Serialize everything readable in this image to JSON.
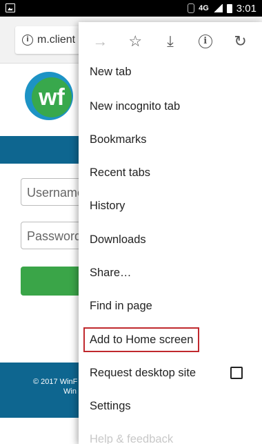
{
  "status_bar": {
    "network": "4G",
    "time": "3:01"
  },
  "address_bar": {
    "url": "m.client"
  },
  "page": {
    "logo_text": "wf",
    "username_placeholder": "Username",
    "password_placeholder": "Password",
    "footer_line1": "© 2017 WinF",
    "footer_line2": "Win"
  },
  "menu": {
    "toolbar": {
      "forward": "→",
      "bookmark": "☆",
      "download": "⤓",
      "info": "i",
      "reload": "↻"
    },
    "items": [
      {
        "label": "New tab"
      },
      {
        "label": "New incognito tab"
      },
      {
        "label": "Bookmarks"
      },
      {
        "label": "Recent tabs"
      },
      {
        "label": "History"
      },
      {
        "label": "Downloads"
      },
      {
        "label": "Share…"
      },
      {
        "label": "Find in page"
      },
      {
        "label": "Add to Home screen"
      },
      {
        "label": "Request desktop site"
      },
      {
        "label": "Settings"
      },
      {
        "label": "Help & feedback"
      }
    ],
    "highlight_color": "#c0282d"
  }
}
